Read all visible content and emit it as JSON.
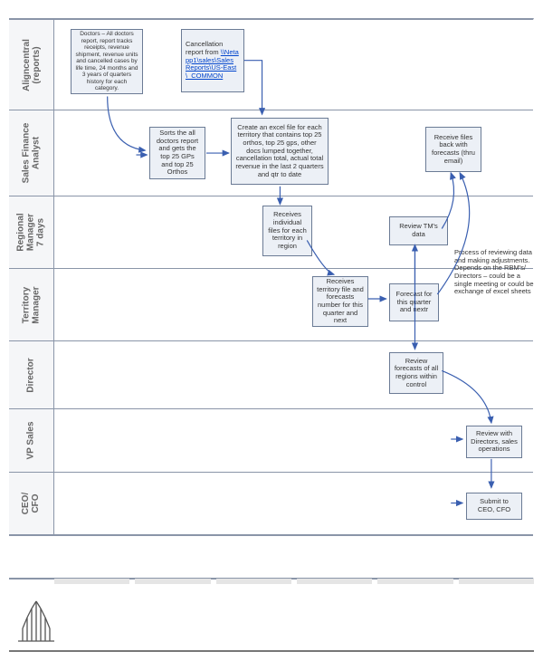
{
  "lanes": {
    "aligncentral": "Aligncentral\n(reports)",
    "sales_finance": "Sales Finance\nAnalyst",
    "regional_mgr": "Regional\nManager\n7 days",
    "territory_mgr": "Territory\nManager",
    "director": "Director",
    "vp_sales": "VP Sales",
    "ceo_cfo": "CEO/\nCFO"
  },
  "boxes": {
    "doctors_report": "Doctors – All doctors report, report tracks receipts, revenue shipment, revenue units and cancelled cases by life time, 24 months and 3 years of quarters history for each category.",
    "cancellation_report_pre": "Cancellation report from ",
    "cancellation_link": "\\\\Netapp1\\sales\\Sales Reports\\US-East\\_COMMON",
    "sorts": "Sorts the all doctors report and gets the top 25 GPs and top 25 Orthos",
    "create_excel": "Create an excel file for each territory that contains top 25 orthos, top 25 gps, other docs lumped together, cancellation total, actual total revenue in the last 2 quarters and qtr to date",
    "receive_files": "Receive files back with forecasts (thru email)",
    "receives_region": "Receives individual files for each territory in region",
    "review_tm": "Review TM's data",
    "receives_territory": "Receives territory file and forecasts number for this quarter and next",
    "forecast": "Forecast for this quarter and nextr",
    "review_regions": "Review forecasts of all regions within control",
    "review_directors": "Review with Directors, sales operations",
    "submit": "Submit to CEO, CFO"
  },
  "annotation": "Process of reviewing data and making adjustments. Depends on the RBM's/ Directors – could be a single meeting or could be exchange of excel sheets",
  "colors": {
    "box_bg": "#ecf0f6",
    "box_border": "#6b7b95",
    "lane_border": "#8a95a8",
    "arrow": "#3a5fb0"
  }
}
